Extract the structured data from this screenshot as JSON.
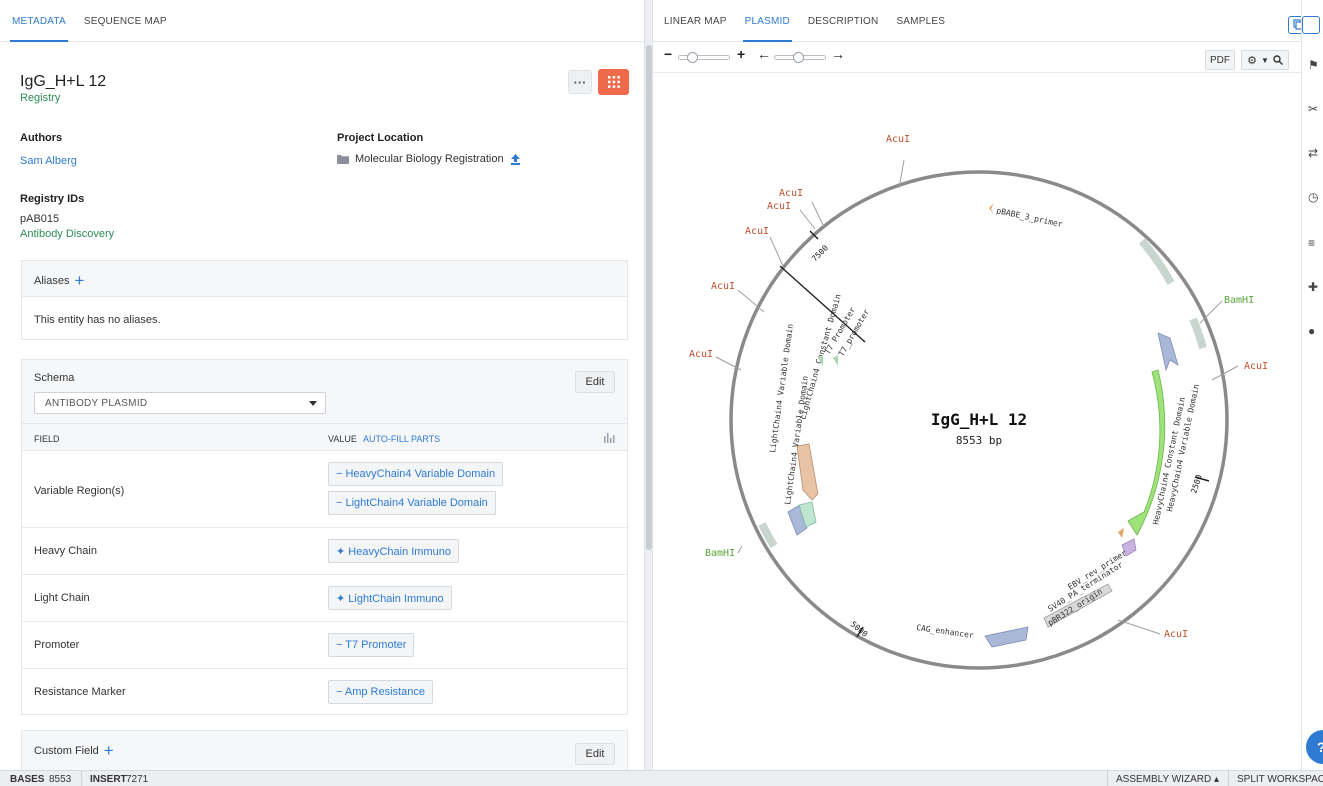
{
  "left_tabs": [
    {
      "label": "METADATA",
      "active": true
    },
    {
      "label": "SEQUENCE MAP",
      "active": false
    }
  ],
  "entity": {
    "name": "IgG_H+L 12",
    "type": "Registry",
    "more_icon": "ellipsis-icon",
    "accent_button_icon": "grid-icon",
    "accent_color": "#ef6a4a"
  },
  "authors": {
    "label": "Authors",
    "value": "Sam Alberg"
  },
  "project_location": {
    "label": "Project Location",
    "value": "Molecular Biology Registration"
  },
  "registry_ids": {
    "label": "Registry IDs",
    "id": "pAB015",
    "registry": "Antibody Discovery"
  },
  "aliases": {
    "title": "Aliases",
    "empty_text": "This entity has no aliases."
  },
  "schema": {
    "title": "Schema",
    "edit_label": "Edit",
    "selected": "ANTIBODY PLASMID",
    "field_header": "FIELD",
    "value_header": "VALUE",
    "autofill_label": "AUTO-FILL PARTS",
    "fields": [
      {
        "name": "Variable Region(s)",
        "values": [
          "− HeavyChain4 Variable Domain",
          "− LightChain4 Variable Domain"
        ]
      },
      {
        "name": "Heavy Chain",
        "values": [
          "✦ HeavyChain Immuno"
        ]
      },
      {
        "name": "Light Chain",
        "values": [
          "✦ LightChain Immuno"
        ]
      },
      {
        "name": "Promoter",
        "values": [
          "− T7 Promoter"
        ]
      },
      {
        "name": "Resistance Marker",
        "values": [
          "− Amp Resistance"
        ]
      }
    ]
  },
  "custom_field": {
    "title": "Custom Field",
    "edit_label": "Edit"
  },
  "right_tabs": [
    {
      "label": "LINEAR MAP",
      "active": false
    },
    {
      "label": "PLASMID",
      "active": true
    },
    {
      "label": "DESCRIPTION",
      "active": false
    },
    {
      "label": "SAMPLES",
      "active": false
    }
  ],
  "toolbar": {
    "zoom_minus": "−",
    "zoom_plus": "+",
    "arrow_left": "←",
    "arrow_right": "→",
    "pdf_label": "PDF",
    "zoom_level": 0.2,
    "rotation_level": 0.45
  },
  "plasmid": {
    "name": "IgG_H+L 12",
    "length_label": "8553 bp",
    "ticks": [
      "2500",
      "5000",
      "7500"
    ],
    "enzymes": [
      {
        "name": "AcuI",
        "color": "#c0502b"
      },
      {
        "name": "AcuI",
        "color": "#c0502b"
      },
      {
        "name": "AcuI",
        "color": "#c0502b"
      },
      {
        "name": "AcuI",
        "color": "#c0502b"
      },
      {
        "name": "AcuI",
        "color": "#c0502b"
      },
      {
        "name": "AcuI",
        "color": "#c0502b"
      },
      {
        "name": "AcuI",
        "color": "#c0502b"
      },
      {
        "name": "AcuI",
        "color": "#c0502b"
      },
      {
        "name": "BamHI",
        "color": "#5aa63a"
      },
      {
        "name": "BamHI",
        "color": "#5aa63a"
      }
    ],
    "features": [
      "pBABE_3_primer",
      "HeavyChain4 Constant Domain",
      "HeavyChain4 Variable Domain",
      "EBV_rev_primer",
      "SV40_PA_terminator",
      "pBR322_origin",
      "CAG_enhancer",
      "LightChain4 Variable Domain",
      "LightChain4 Variable Domain",
      "LightChain4 Constant Domain",
      "T7 Promoter",
      "T7_promoter"
    ]
  },
  "status": {
    "bases_label": "BASES",
    "bases_value": "8553",
    "insert_label": "INSERT",
    "insert_value": "7271",
    "assembly_wizard": "ASSEMBLY WIZARD ▴",
    "split_workspace": "SPLIT WORKSPACE"
  },
  "help_label": "?",
  "rail_icons": [
    "flag-icon",
    "scissors-icon",
    "shuffle-icon",
    "clock-icon",
    "list-icon",
    "plus-icon",
    "info-icon"
  ]
}
